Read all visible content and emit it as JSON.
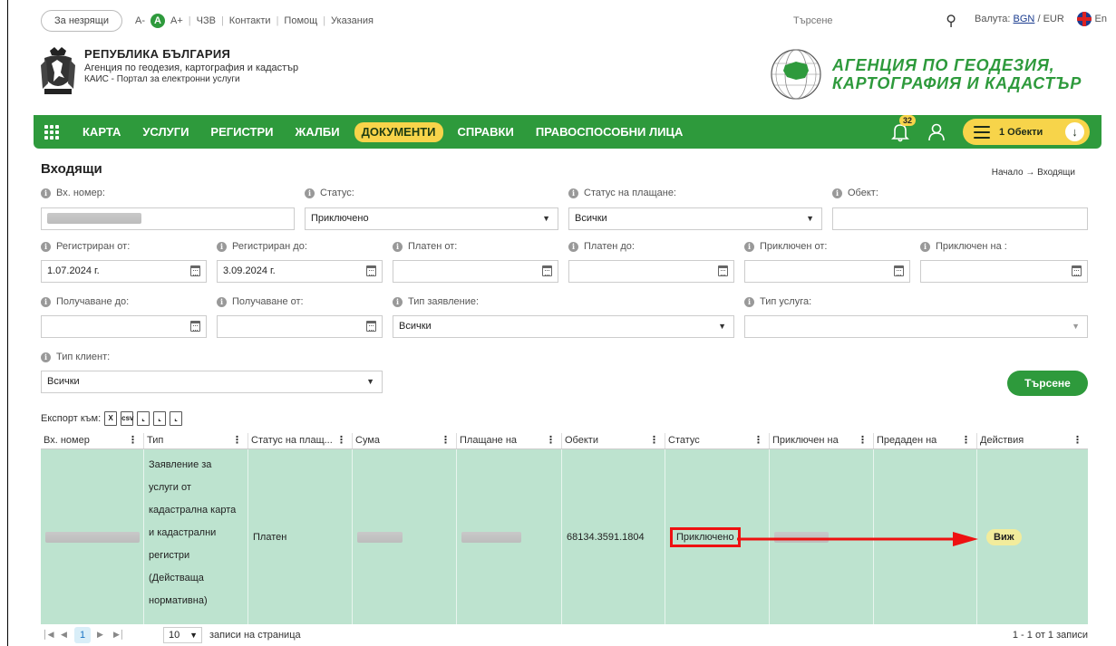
{
  "topbar": {
    "no_images_btn": "За незрящи",
    "font_smaller": "A-",
    "font_normal": "A",
    "font_larger": "A+",
    "links": [
      "ЧЗВ",
      "Контакти",
      "Помощ",
      "Указания"
    ],
    "search_placeholder": "Търсене",
    "currency_prefix": "Валута:",
    "currency_bgn": "BGN",
    "currency_sep": "/",
    "currency_eur": "EUR",
    "lang": "En"
  },
  "branding": {
    "republic": "РЕПУБЛИКА БЪЛГАРИЯ",
    "agency_small": "Агенция по геодезия, картография и кадастър",
    "portal": "КАИС - Портал за електронни услуги",
    "agency_big_line1": "АГЕНЦИЯ ПО ГЕОДЕЗИЯ,",
    "agency_big_line2": "КАРТОГРАФИЯ И КАДАСТЪР"
  },
  "nav": {
    "items": [
      "КАРТА",
      "УСЛУГИ",
      "РЕГИСТРИ",
      "ЖАЛБИ",
      "ДОКУМЕНТИ",
      "СПРАВКИ",
      "ПРАВОСПОСОБНИ ЛИЦА"
    ],
    "active": "ДОКУМЕНТИ",
    "notifications": "32",
    "objects_label": "1 Обекти"
  },
  "page": {
    "title": "Входящи",
    "breadcrumb_home": "Начало",
    "breadcrumb_arrow": "→",
    "breadcrumb_current": "Входящи"
  },
  "filters": {
    "incoming_no": "Вх. номер:",
    "status": "Статус:",
    "status_value": "Приключено",
    "payment_status": "Статус на плащане:",
    "payment_status_value": "Всички",
    "object": "Обект:",
    "registered_from": "Регистриран от:",
    "registered_from_value": "1.07.2024 г.",
    "registered_to": "Регистриран до:",
    "registered_to_value": "3.09.2024 г.",
    "paid_from": "Платен от:",
    "paid_to": "Платен до:",
    "closed_from": "Приключен от:",
    "closed_on": "Приключен на :",
    "receipt_to": "Получаване до:",
    "receipt_from": "Получаване от:",
    "application_type": "Тип заявление:",
    "application_type_value": "Всички",
    "service_type": "Тип услуга:",
    "client_type": "Тип клиент:",
    "client_type_value": "Всички",
    "search_btn": "Търсене"
  },
  "export": {
    "label": "Експорт към:",
    "formats": [
      "xls-icon",
      "csv-icon",
      "pdf-icon",
      "pdf-icon",
      "pdf-icon"
    ]
  },
  "grid": {
    "headers": [
      "Вх. номер",
      "Тип",
      "Статус на плащ...",
      "Сума",
      "Плащане на",
      "Обекти",
      "Статус",
      "Приключен на",
      "Предаден на",
      "Действия"
    ],
    "row": {
      "type_lines": [
        "Заявление за",
        "услуги от",
        "кадастрална карта",
        "и кадастрални",
        "регистри",
        "(Действаща",
        "нормативна)"
      ],
      "payment_status": "Платен",
      "objects": "68134.3591.1804",
      "status": "Приключено",
      "action": "Виж"
    }
  },
  "pager": {
    "current_page": "1",
    "per_page": "10",
    "per_page_label": "записи на страница",
    "info": "1 - 1 от 1 записи"
  },
  "colors": {
    "brand_green": "#2e9a3c",
    "active_yellow": "#f7d44a",
    "row_highlight": "#bde3cf",
    "annotation_red": "#e11111"
  }
}
